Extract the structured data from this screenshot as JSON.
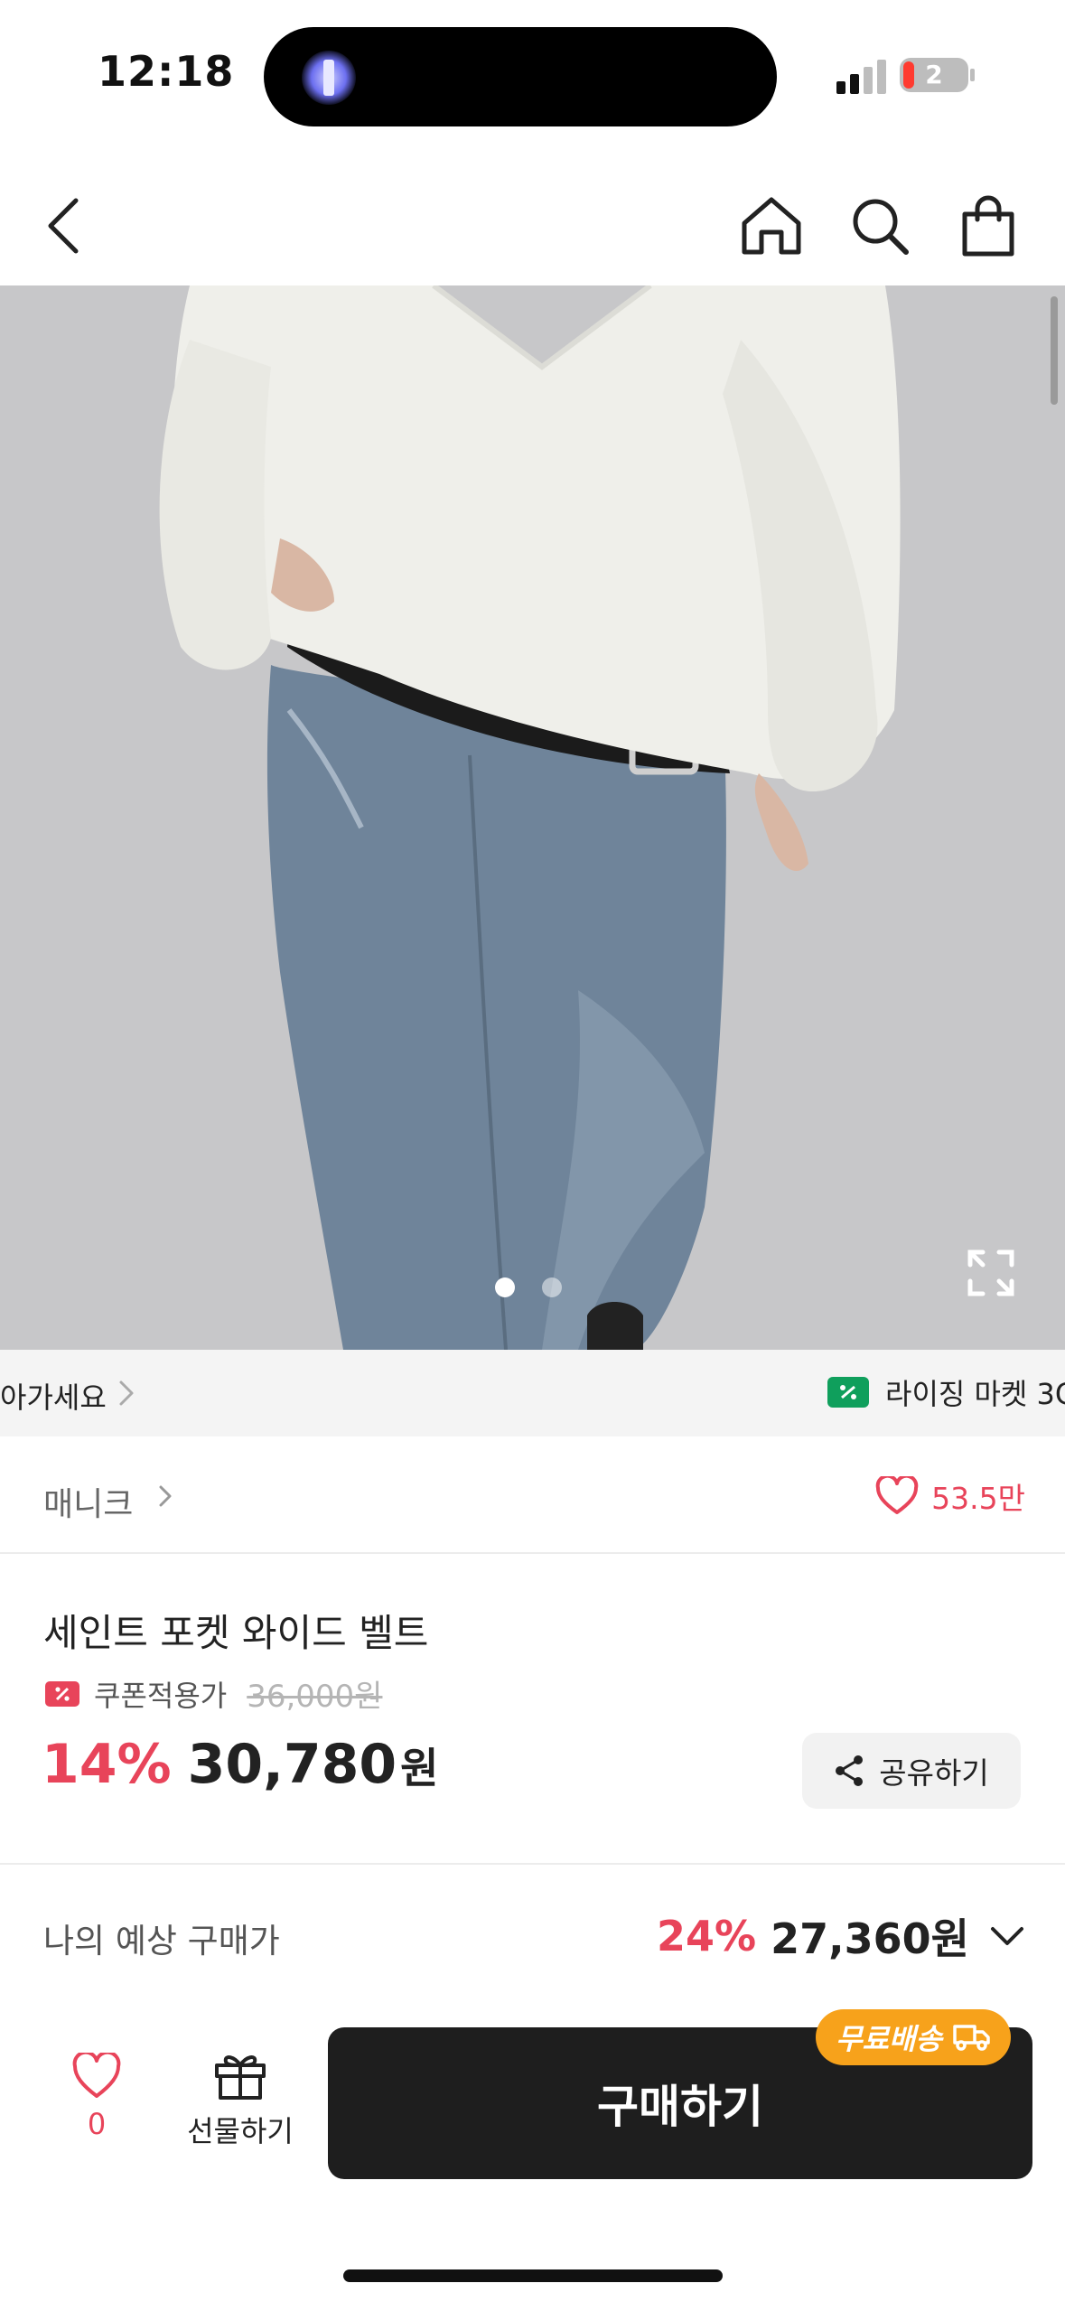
{
  "status_bar": {
    "time": "12:18",
    "battery": "2"
  },
  "nav": {
    "back_icon": "chevron-left-icon",
    "home_icon": "home-icon",
    "search_icon": "search-icon",
    "cart_icon": "shopping-bag-icon"
  },
  "gallery": {
    "total_images": 2,
    "active_index": 0,
    "expand_icon": "expand-icon"
  },
  "banner": {
    "left_text": "아가세요",
    "right_text": "라이징 마켓 3C",
    "right_icon": "coupon-icon"
  },
  "brand": {
    "name": "매니크",
    "likes": "53.5만"
  },
  "product": {
    "title": "세인트 포켓 와이드 벨트",
    "coupon_label": "쿠폰적용가",
    "original_price": "36,000원",
    "discount": "14%",
    "price": "30,780",
    "currency": "원",
    "share_label": "공유하기"
  },
  "expected_price": {
    "label": "나의 예상 구매가",
    "discount": "24%",
    "price": "27,360원"
  },
  "bottom_bar": {
    "wish_count": "0",
    "gift_label": "선물하기",
    "buy_label": "구매하기",
    "free_shipping_label": "무료배송"
  },
  "colors": {
    "accent": "#e8445a",
    "badge": "#f7a21b",
    "buy_button": "#1e1e1e",
    "coupon_green": "#0f9f5c"
  }
}
